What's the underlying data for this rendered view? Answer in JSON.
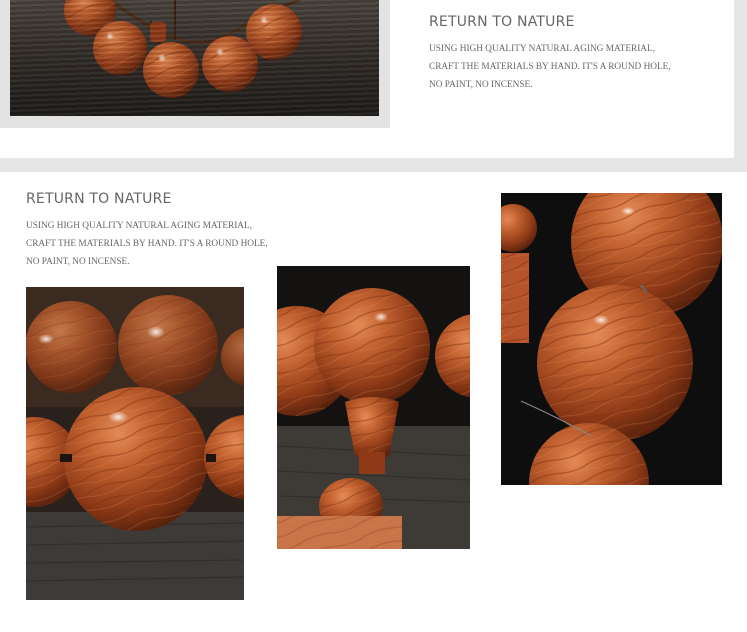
{
  "top_section": {
    "heading": "RETURN TO NATURE",
    "lines": [
      "USING HIGH QUALITY NATURAL AGING MATERIAL,",
      "CRAFT THE MATERIALS BY HAND. IT'S A ROUND HOLE,",
      "NO PAINT, NO INCENSE."
    ]
  },
  "main_section": {
    "heading": "RETURN TO NATURE",
    "lines": [
      "USING HIGH QUALITY NATURAL AGING MATERIAL,",
      "CRAFT THE MATERIALS BY HAND. IT'S A ROUND HOLE,",
      "NO PAINT, NO INCENSE."
    ]
  },
  "colors": {
    "wood_bead": "#b5532a",
    "wood_dark": "#6e2a12",
    "background_dark": "#1e1b18",
    "text": "#666666"
  }
}
